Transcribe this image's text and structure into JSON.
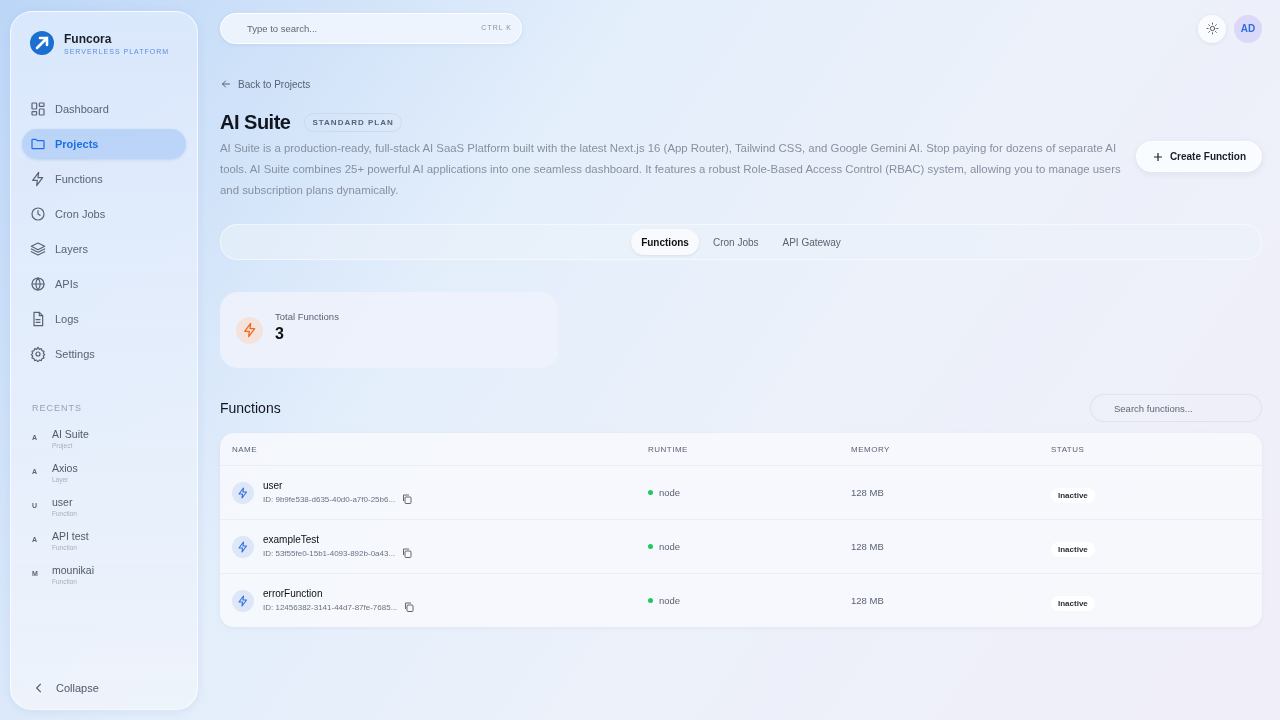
{
  "brand": {
    "name": "Funcora",
    "tagline": "SERVERLESS PLATFORM"
  },
  "nav": [
    {
      "label": "Dashboard",
      "selected": false
    },
    {
      "label": "Projects",
      "selected": true
    },
    {
      "label": "Functions",
      "selected": false
    },
    {
      "label": "Cron Jobs",
      "selected": false
    },
    {
      "label": "Layers",
      "selected": false
    },
    {
      "label": "APIs",
      "selected": false
    },
    {
      "label": "Logs",
      "selected": false
    },
    {
      "label": "Settings",
      "selected": false
    }
  ],
  "recents": {
    "heading": "RECENTS",
    "items": [
      {
        "initial": "A",
        "name": "AI Suite",
        "type": "Project"
      },
      {
        "initial": "A",
        "name": "Axios",
        "type": "Layer"
      },
      {
        "initial": "U",
        "name": "user",
        "type": "Function"
      },
      {
        "initial": "A",
        "name": "API test",
        "type": "Function"
      },
      {
        "initial": "M",
        "name": "mounikai",
        "type": "Function"
      }
    ]
  },
  "collapse": "Collapse",
  "search": {
    "placeholder": "Type to search...",
    "shortcut": "CTRL K"
  },
  "avatar": "AD",
  "back": "Back to Projects",
  "project": {
    "title": "AI Suite",
    "plan": "STANDARD PLAN",
    "description": "AI Suite is a production-ready, full-stack AI SaaS Platform built with the latest Next.js 16 (App Router), Tailwind CSS, and Google Gemini AI. Stop paying for dozens of separate AI tools. AI Suite combines 25+ powerful AI applications into one seamless dashboard. It features a robust Role-Based Access Control (RBAC) system, allowing you to manage users and subscription plans dynamically."
  },
  "create_button": "Create Function",
  "tabs": [
    {
      "label": "Functions",
      "selected": true
    },
    {
      "label": "Cron Jobs",
      "selected": false
    },
    {
      "label": "API Gateway",
      "selected": false
    }
  ],
  "stat": {
    "label": "Total Functions",
    "value": "3"
  },
  "functions": {
    "heading": "Functions",
    "search_placeholder": "Search functions...",
    "columns": [
      "NAME",
      "RUNTIME",
      "MEMORY",
      "STATUS"
    ],
    "rows": [
      {
        "name": "user",
        "id": "ID: 9b9fe538-d635-40d0-a7f0-25b6...",
        "runtime": "node",
        "memory": "128 MB",
        "status": "Inactive"
      },
      {
        "name": "exampleTest",
        "id": "ID: 53f55fe0-15b1-4093-892b-0a43...",
        "runtime": "node",
        "memory": "128 MB",
        "status": "Inactive"
      },
      {
        "name": "errorFunction",
        "id": "ID: 12456382-3141-44d7-87fe-7685...",
        "runtime": "node",
        "memory": "128 MB",
        "status": "Inactive"
      }
    ]
  }
}
